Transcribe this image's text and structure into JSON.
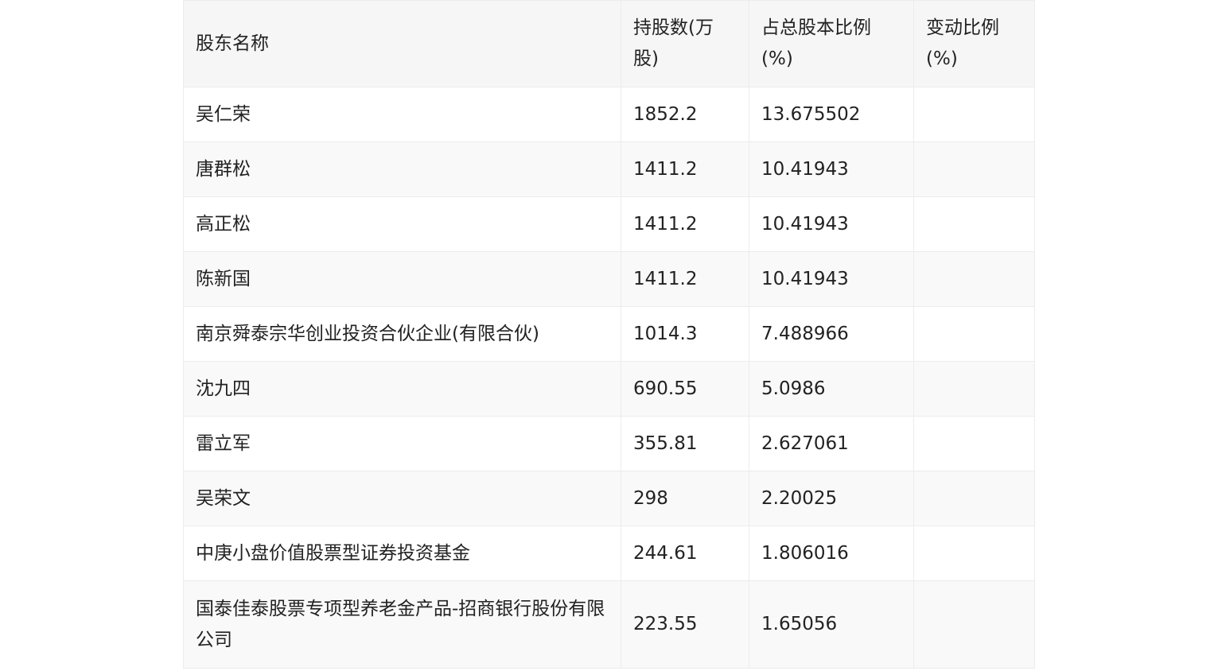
{
  "table": {
    "headers": {
      "name": "股东名称",
      "shares": "持股数(万股)",
      "percent": "占总股本比例(%)",
      "change": "变动比例(%)"
    },
    "rows": [
      {
        "name": "吴仁荣",
        "shares": "1852.2",
        "percent": "13.675502",
        "change": ""
      },
      {
        "name": "唐群松",
        "shares": "1411.2",
        "percent": "10.41943",
        "change": ""
      },
      {
        "name": "高正松",
        "shares": "1411.2",
        "percent": "10.41943",
        "change": ""
      },
      {
        "name": "陈新国",
        "shares": "1411.2",
        "percent": "10.41943",
        "change": ""
      },
      {
        "name": "南京舜泰宗华创业投资合伙企业(有限合伙)",
        "shares": "1014.3",
        "percent": "7.488966",
        "change": ""
      },
      {
        "name": "沈九四",
        "shares": "690.55",
        "percent": "5.0986",
        "change": ""
      },
      {
        "name": "雷立军",
        "shares": "355.81",
        "percent": "2.627061",
        "change": ""
      },
      {
        "name": "吴荣文",
        "shares": "298",
        "percent": "2.20025",
        "change": ""
      },
      {
        "name": "中庚小盘价值股票型证券投资基金",
        "shares": "244.61",
        "percent": "1.806016",
        "change": ""
      },
      {
        "name": "国泰佳泰股票专项型养老金产品-招商银行股份有限公司",
        "shares": "223.55",
        "percent": "1.65056",
        "change": ""
      }
    ]
  }
}
